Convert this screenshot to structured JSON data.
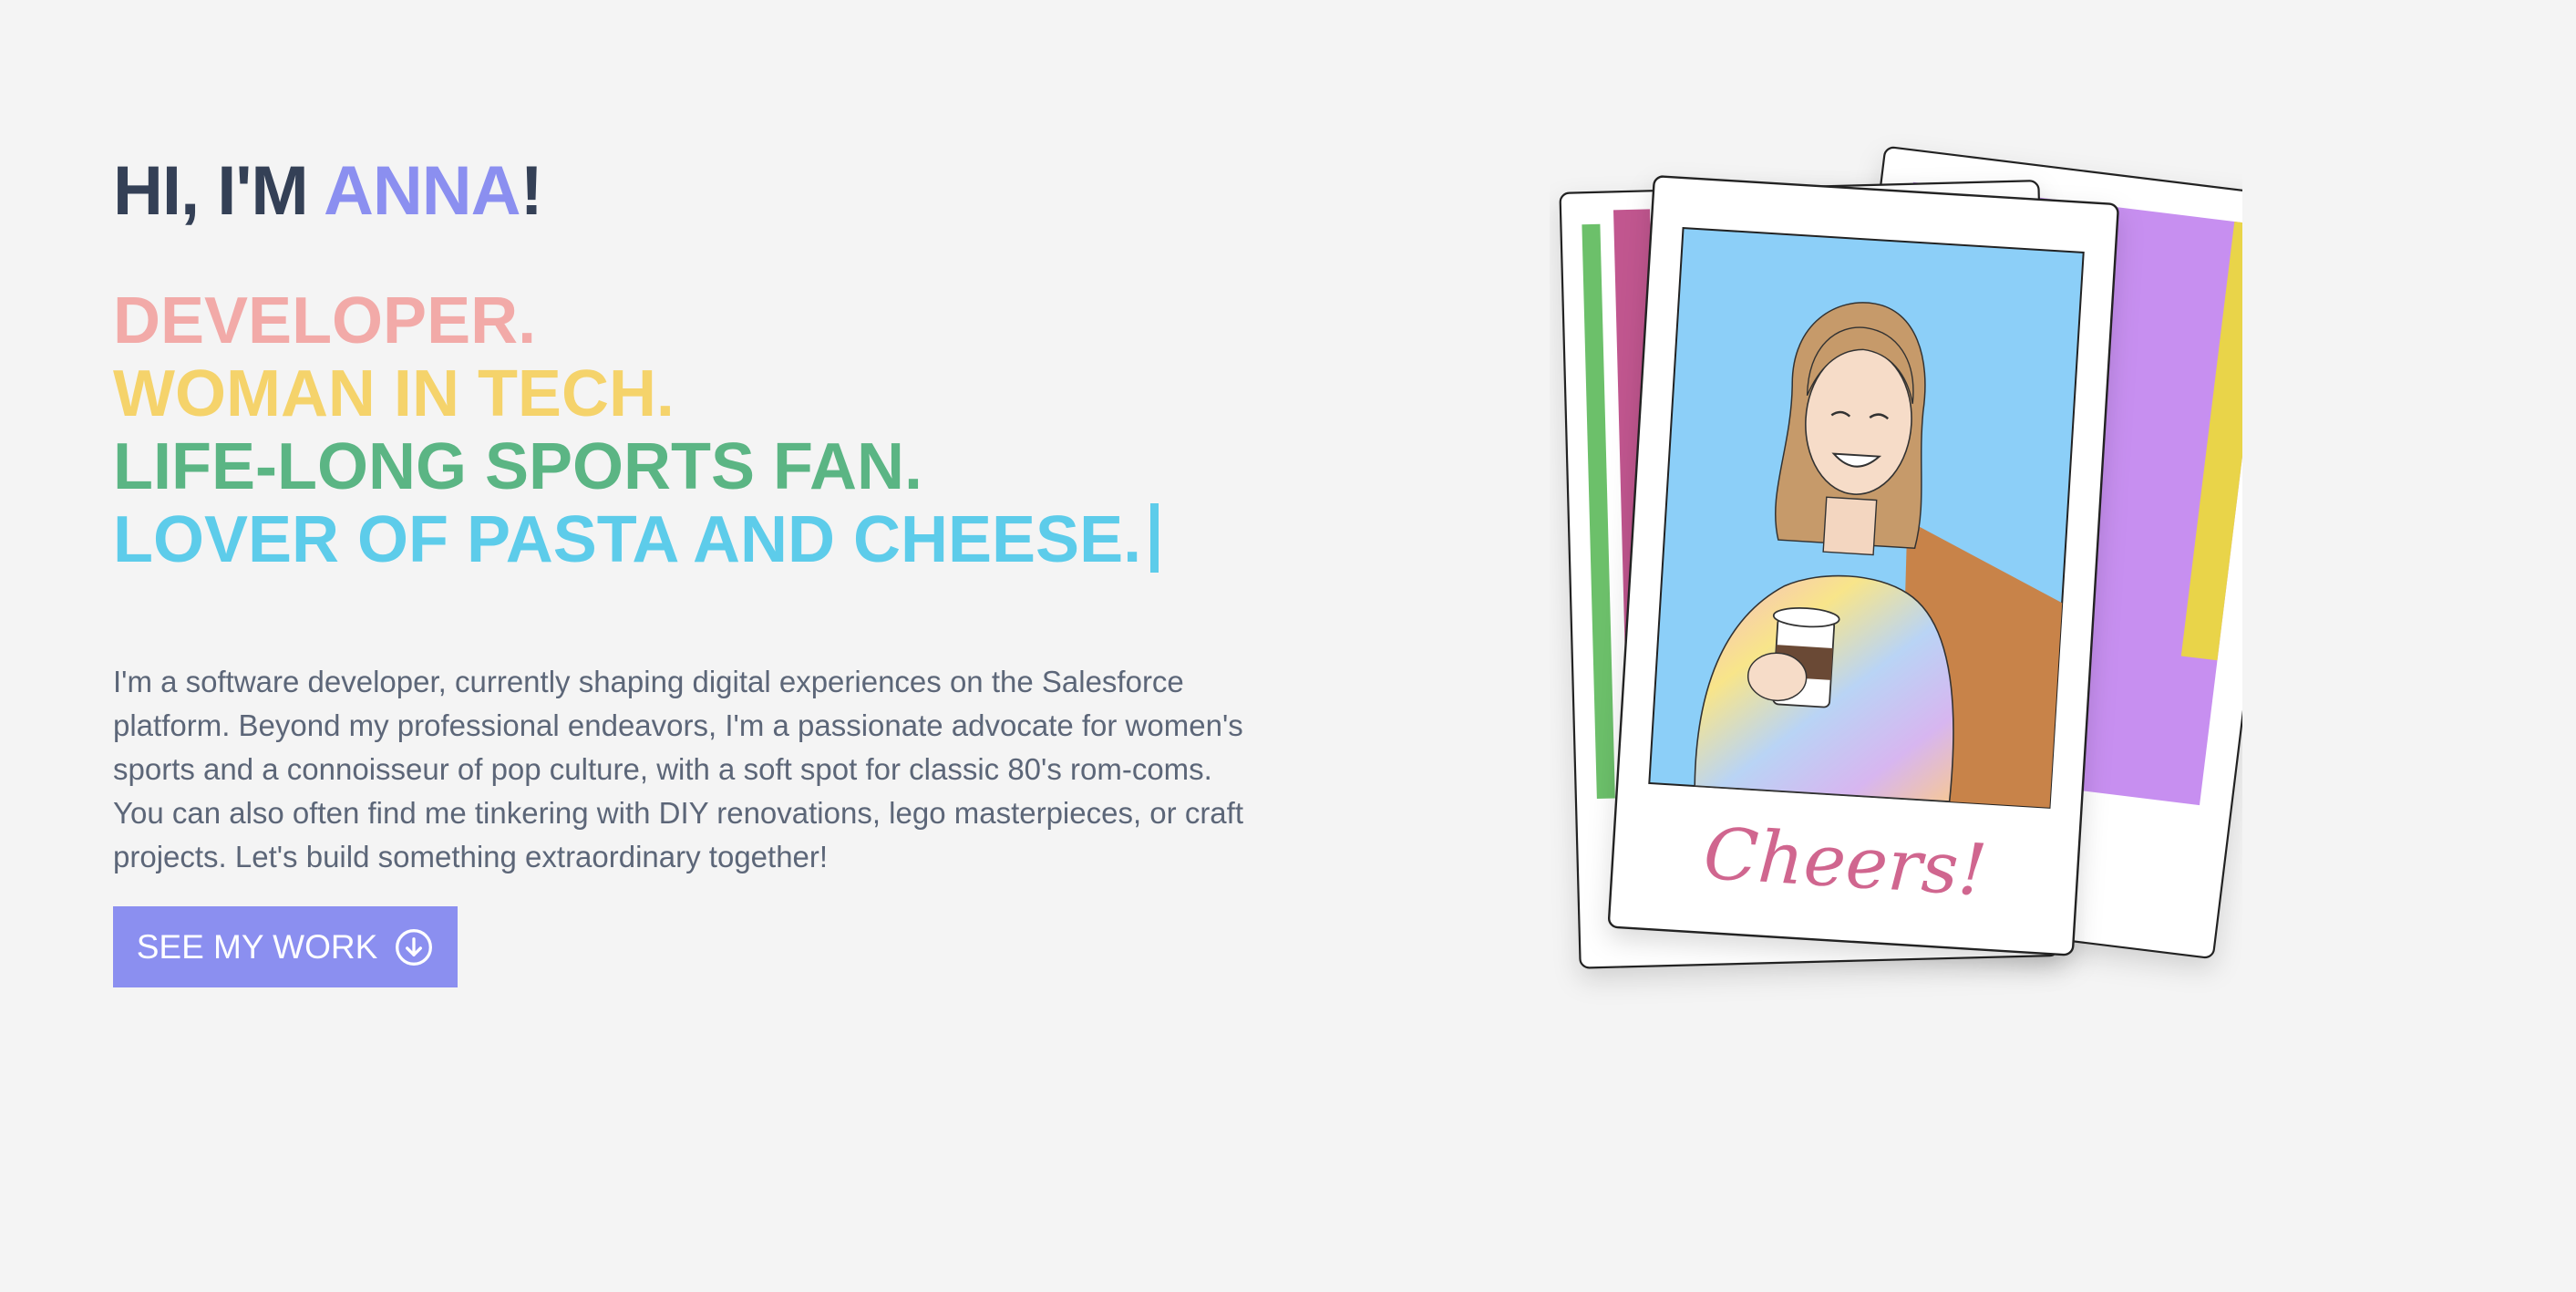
{
  "hero": {
    "greeting_prefix": "HI, I'M ",
    "greeting_name": "ANNA",
    "greeting_suffix": "!",
    "roles": [
      "DEVELOPER.",
      "WOMAN IN TECH.",
      "LIFE-LONG SPORTS FAN.",
      "LOVER OF PASTA AND CHEESE."
    ],
    "bio": "I'm a software developer, currently shaping digital experiences on the Salesforce platform. Beyond my professional endeavors, I'm a passionate advocate for women's sports and a connoisseur of pop culture, with a soft spot for classic 80's rom-coms. You can also often find me tinkering with DIY renovations, lego masterpieces, or craft projects. Let's build something extraordinary together!",
    "cta_label": "SEE MY WORK",
    "cta_icon": "arrow-down-circle-icon"
  },
  "illustration": {
    "caption": "Cheers!"
  },
  "colors": {
    "background": "#f4f4f4",
    "heading": "#344056",
    "accent": "#8b8ff0",
    "role_1": "#f2aaa8",
    "role_2": "#f5d36b",
    "role_3": "#5bb584",
    "role_4": "#5dccea",
    "body_text": "#5c6678"
  }
}
